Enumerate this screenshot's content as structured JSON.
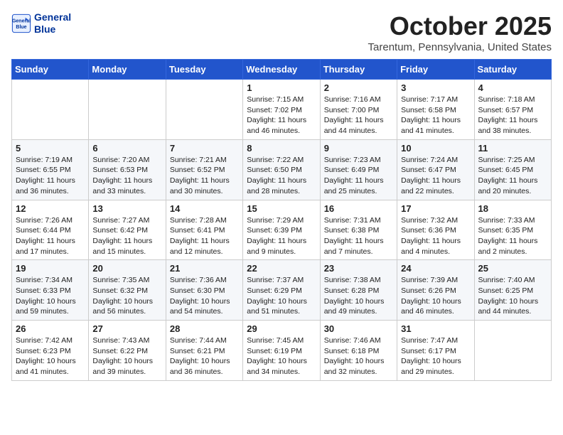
{
  "header": {
    "logo_line1": "General",
    "logo_line2": "Blue",
    "month": "October 2025",
    "location": "Tarentum, Pennsylvania, United States"
  },
  "weekdays": [
    "Sunday",
    "Monday",
    "Tuesday",
    "Wednesday",
    "Thursday",
    "Friday",
    "Saturday"
  ],
  "weeks": [
    [
      {
        "day": "",
        "info": ""
      },
      {
        "day": "",
        "info": ""
      },
      {
        "day": "",
        "info": ""
      },
      {
        "day": "1",
        "info": "Sunrise: 7:15 AM\nSunset: 7:02 PM\nDaylight: 11 hours\nand 46 minutes."
      },
      {
        "day": "2",
        "info": "Sunrise: 7:16 AM\nSunset: 7:00 PM\nDaylight: 11 hours\nand 44 minutes."
      },
      {
        "day": "3",
        "info": "Sunrise: 7:17 AM\nSunset: 6:58 PM\nDaylight: 11 hours\nand 41 minutes."
      },
      {
        "day": "4",
        "info": "Sunrise: 7:18 AM\nSunset: 6:57 PM\nDaylight: 11 hours\nand 38 minutes."
      }
    ],
    [
      {
        "day": "5",
        "info": "Sunrise: 7:19 AM\nSunset: 6:55 PM\nDaylight: 11 hours\nand 36 minutes."
      },
      {
        "day": "6",
        "info": "Sunrise: 7:20 AM\nSunset: 6:53 PM\nDaylight: 11 hours\nand 33 minutes."
      },
      {
        "day": "7",
        "info": "Sunrise: 7:21 AM\nSunset: 6:52 PM\nDaylight: 11 hours\nand 30 minutes."
      },
      {
        "day": "8",
        "info": "Sunrise: 7:22 AM\nSunset: 6:50 PM\nDaylight: 11 hours\nand 28 minutes."
      },
      {
        "day": "9",
        "info": "Sunrise: 7:23 AM\nSunset: 6:49 PM\nDaylight: 11 hours\nand 25 minutes."
      },
      {
        "day": "10",
        "info": "Sunrise: 7:24 AM\nSunset: 6:47 PM\nDaylight: 11 hours\nand 22 minutes."
      },
      {
        "day": "11",
        "info": "Sunrise: 7:25 AM\nSunset: 6:45 PM\nDaylight: 11 hours\nand 20 minutes."
      }
    ],
    [
      {
        "day": "12",
        "info": "Sunrise: 7:26 AM\nSunset: 6:44 PM\nDaylight: 11 hours\nand 17 minutes."
      },
      {
        "day": "13",
        "info": "Sunrise: 7:27 AM\nSunset: 6:42 PM\nDaylight: 11 hours\nand 15 minutes."
      },
      {
        "day": "14",
        "info": "Sunrise: 7:28 AM\nSunset: 6:41 PM\nDaylight: 11 hours\nand 12 minutes."
      },
      {
        "day": "15",
        "info": "Sunrise: 7:29 AM\nSunset: 6:39 PM\nDaylight: 11 hours\nand 9 minutes."
      },
      {
        "day": "16",
        "info": "Sunrise: 7:31 AM\nSunset: 6:38 PM\nDaylight: 11 hours\nand 7 minutes."
      },
      {
        "day": "17",
        "info": "Sunrise: 7:32 AM\nSunset: 6:36 PM\nDaylight: 11 hours\nand 4 minutes."
      },
      {
        "day": "18",
        "info": "Sunrise: 7:33 AM\nSunset: 6:35 PM\nDaylight: 11 hours\nand 2 minutes."
      }
    ],
    [
      {
        "day": "19",
        "info": "Sunrise: 7:34 AM\nSunset: 6:33 PM\nDaylight: 10 hours\nand 59 minutes."
      },
      {
        "day": "20",
        "info": "Sunrise: 7:35 AM\nSunset: 6:32 PM\nDaylight: 10 hours\nand 56 minutes."
      },
      {
        "day": "21",
        "info": "Sunrise: 7:36 AM\nSunset: 6:30 PM\nDaylight: 10 hours\nand 54 minutes."
      },
      {
        "day": "22",
        "info": "Sunrise: 7:37 AM\nSunset: 6:29 PM\nDaylight: 10 hours\nand 51 minutes."
      },
      {
        "day": "23",
        "info": "Sunrise: 7:38 AM\nSunset: 6:28 PM\nDaylight: 10 hours\nand 49 minutes."
      },
      {
        "day": "24",
        "info": "Sunrise: 7:39 AM\nSunset: 6:26 PM\nDaylight: 10 hours\nand 46 minutes."
      },
      {
        "day": "25",
        "info": "Sunrise: 7:40 AM\nSunset: 6:25 PM\nDaylight: 10 hours\nand 44 minutes."
      }
    ],
    [
      {
        "day": "26",
        "info": "Sunrise: 7:42 AM\nSunset: 6:23 PM\nDaylight: 10 hours\nand 41 minutes."
      },
      {
        "day": "27",
        "info": "Sunrise: 7:43 AM\nSunset: 6:22 PM\nDaylight: 10 hours\nand 39 minutes."
      },
      {
        "day": "28",
        "info": "Sunrise: 7:44 AM\nSunset: 6:21 PM\nDaylight: 10 hours\nand 36 minutes."
      },
      {
        "day": "29",
        "info": "Sunrise: 7:45 AM\nSunset: 6:19 PM\nDaylight: 10 hours\nand 34 minutes."
      },
      {
        "day": "30",
        "info": "Sunrise: 7:46 AM\nSunset: 6:18 PM\nDaylight: 10 hours\nand 32 minutes."
      },
      {
        "day": "31",
        "info": "Sunrise: 7:47 AM\nSunset: 6:17 PM\nDaylight: 10 hours\nand 29 minutes."
      },
      {
        "day": "",
        "info": ""
      }
    ]
  ]
}
